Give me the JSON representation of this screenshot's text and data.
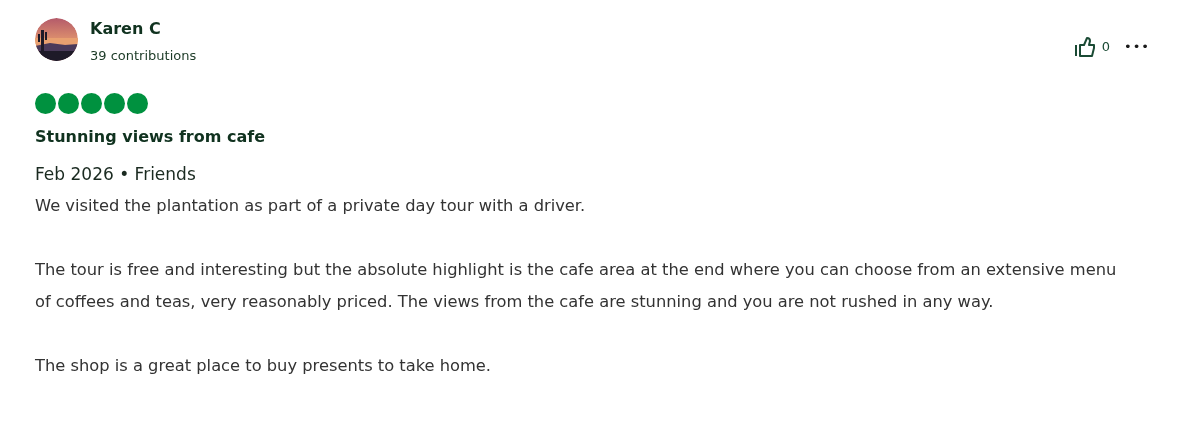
{
  "author": {
    "name": "Karen C",
    "contributions": "39 contributions"
  },
  "helpful": {
    "count": "0"
  },
  "more": "•••",
  "rating": {
    "stars": 5
  },
  "title": "Stunning views from cafe",
  "meta": "Feb 2026 • Friends",
  "paragraphs": [
    "We visited the plantation as part of a private day tour with a driver.",
    "The tour is free and interesting but the absolute highlight is the cafe area at the end where you can choose from an extensive menu of coffees and teas, very reasonably priced. The views from the cafe are stunning and you are not rushed in any way.",
    "The shop is a great place to buy presents to take home."
  ]
}
